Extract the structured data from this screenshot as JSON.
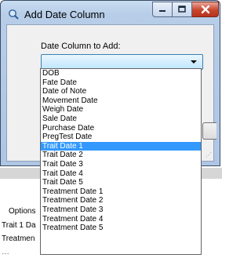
{
  "window": {
    "title": "Add Date Column"
  },
  "form": {
    "label": "Date Column to Add:",
    "selected_value": ""
  },
  "dropdown": {
    "options": [
      "DOB",
      "Fate Date",
      "Date of Note",
      "Movement Date",
      "Weigh Date",
      "Sale Date",
      "Purchase Date",
      "PregTest Date",
      "Trait Date 1",
      "Trait Date 2",
      "Trait Date 3",
      "Trait Date 4",
      "Trait Date 5",
      "Treatment Date 1",
      "Treatment Date 2",
      "Treatment Date 3",
      "Treatment Date 4",
      "Treatment Date 5"
    ],
    "highlighted": "Trait Date 1"
  },
  "background": {
    "options_label": "Options",
    "row1": "Trait 1 Da",
    "row2": "Treatmen",
    "row3": "…"
  },
  "colors": {
    "highlight": "#3399ff",
    "close_button": "#c7452d",
    "titlebar": "#b7cde8"
  }
}
